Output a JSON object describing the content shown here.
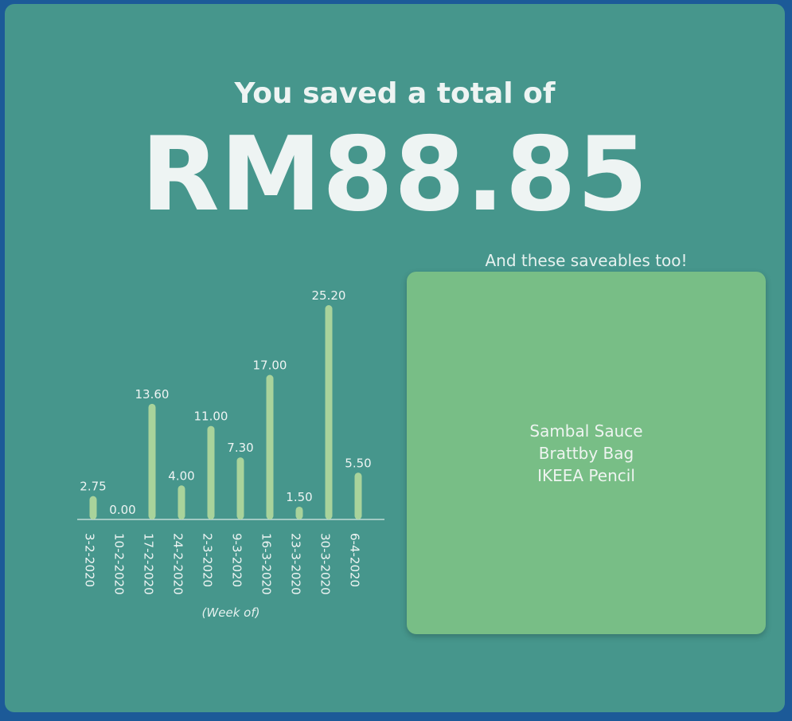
{
  "summary": {
    "heading": "You saved a total of",
    "amount": "RM88.85"
  },
  "saveables": {
    "title": "And these saveables too!",
    "items": [
      "Sambal Sauce",
      "Brattby Bag",
      "IKEEA Pencil"
    ]
  },
  "colors": {
    "background": "#1c5a98",
    "card": "#46968c",
    "bar": "#a9d39b",
    "saveables_box": "#78be86",
    "text": "#eef4f3"
  },
  "chart_data": {
    "type": "bar",
    "categories": [
      "3-2-2020",
      "10-2-2020",
      "17-2-2020",
      "24-2-2020",
      "2-3-2020",
      "9-3-2020",
      "16-3-2020",
      "23-3-2020",
      "30-3-2020",
      "6-4-2020"
    ],
    "values": [
      2.75,
      0.0,
      13.6,
      4.0,
      11.0,
      7.3,
      17.0,
      1.5,
      25.2,
      5.5
    ],
    "value_labels": [
      "2.75",
      "0.00",
      "13.60",
      "4.00",
      "11.00",
      "7.30",
      "17.00",
      "1.50",
      "25.20",
      "5.50"
    ],
    "xlabel": "(Week of)",
    "ylabel": "",
    "title": "",
    "ylim": [
      0,
      25.2
    ],
    "grid": false,
    "legend": "none"
  }
}
